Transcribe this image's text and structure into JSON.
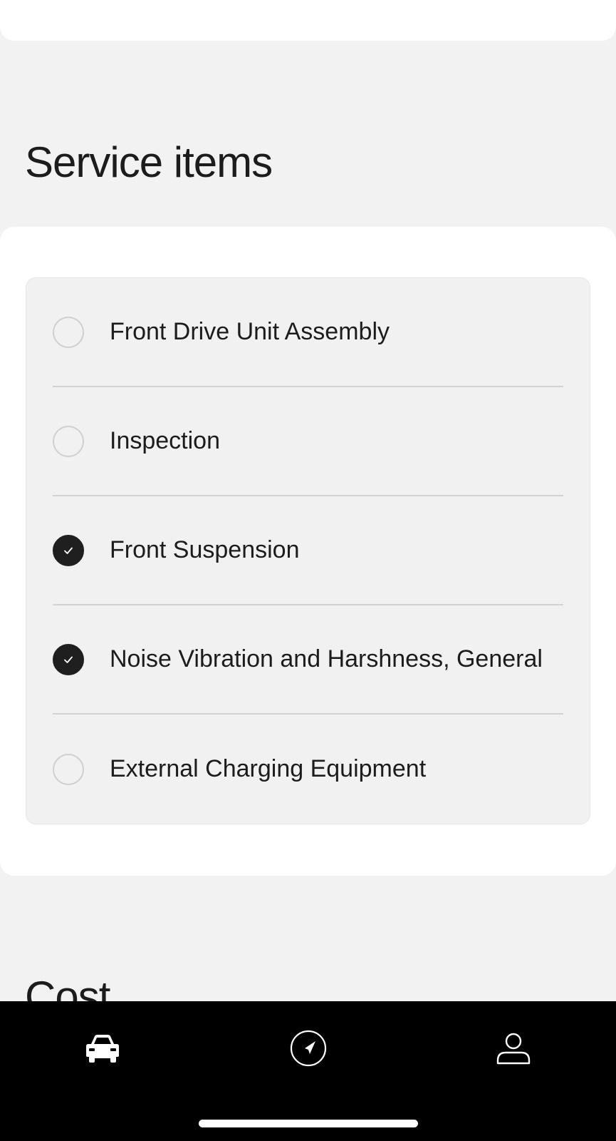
{
  "service_items": {
    "title": "Service items",
    "items": [
      {
        "label": "Front Drive Unit Assembly",
        "checked": false
      },
      {
        "label": "Inspection",
        "checked": false
      },
      {
        "label": "Front Suspension",
        "checked": true
      },
      {
        "label": "Noise Vibration and Harshness, General",
        "checked": true
      },
      {
        "label": "External Charging Equipment",
        "checked": false
      }
    ]
  },
  "cost": {
    "title": "Cost"
  },
  "tab_bar": {
    "tabs": [
      {
        "icon": "vehicle-icon",
        "active": true
      },
      {
        "icon": "navigation-icon",
        "active": false
      },
      {
        "icon": "account-icon",
        "active": false
      }
    ]
  },
  "colors": {
    "background": "#f2f2f2",
    "card": "#ffffff",
    "checked": "#1f1f1f",
    "tab_bar": "#000000"
  }
}
